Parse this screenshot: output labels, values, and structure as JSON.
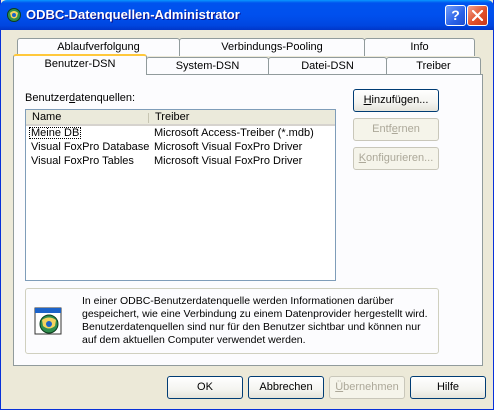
{
  "window": {
    "title": "ODBC-Datenquellen-Administrator",
    "help_glyph": "?"
  },
  "tabs_back": [
    {
      "label": "Ablaufverfolgung"
    },
    {
      "label": "Verbindungs-Pooling"
    },
    {
      "label": "Info"
    }
  ],
  "tabs_front": [
    {
      "label": "Benutzer-DSN",
      "active": true
    },
    {
      "label": "System-DSN"
    },
    {
      "label": "Datei-DSN"
    },
    {
      "label": "Treiber"
    }
  ],
  "panel": {
    "list_label": {
      "before": "Benutzer",
      "mnemonic": "d",
      "after": "atenquellen:"
    },
    "columns": [
      "Name",
      "Treiber"
    ],
    "rows": [
      {
        "name": "Meine DB",
        "driver": "Microsoft Access-Treiber (*.mdb)"
      },
      {
        "name": "Visual FoxPro Database",
        "driver": "Microsoft Visual FoxPro Driver"
      },
      {
        "name": "Visual FoxPro Tables",
        "driver": "Microsoft Visual FoxPro Driver"
      }
    ],
    "buttons": {
      "add": {
        "mnemonic": "H",
        "rest": "inzufügen..."
      },
      "remove": {
        "before": "Entf",
        "mnemonic": "e",
        "after": "rnen"
      },
      "configure": {
        "mnemonic": "K",
        "rest": "onfigurieren..."
      }
    },
    "info_text": "In einer ODBC-Benutzerdatenquelle werden Informationen darüber gespeichert, wie eine Verbindung zu einem Datenprovider hergestellt wird. Benutzerdatenquellen sind nur für den Benutzer sichtbar und können nur auf dem aktuellen Computer verwendet werden."
  },
  "footer": {
    "ok": "OK",
    "cancel": "Abbrechen",
    "apply": {
      "mnemonic": "Ü",
      "rest": "bernehmen"
    },
    "help": "Hilfe"
  },
  "colors": {
    "titlebar": "#0053ee",
    "face": "#ece9d8",
    "tab_highlight": "#ffc83c",
    "border": "#919b9c"
  }
}
